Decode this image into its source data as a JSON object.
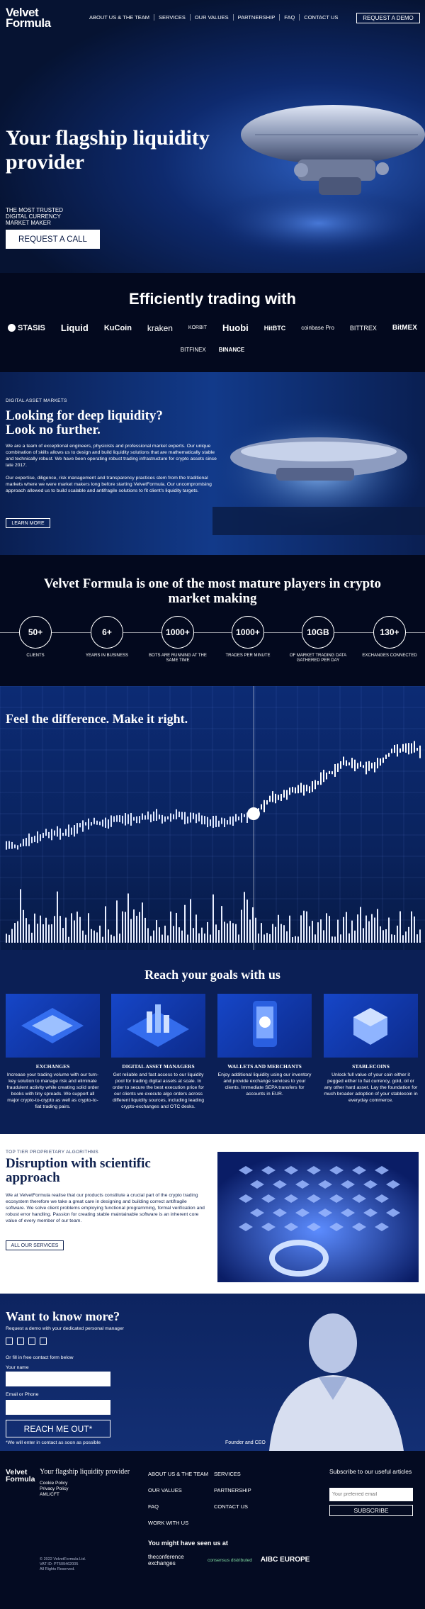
{
  "header": {
    "logo_line1": "Velvet",
    "logo_line2": "Formula",
    "nav": [
      "ABOUT US & THE TEAM",
      "SERVICES",
      "OUR VALUES",
      "PARTNERSHIP",
      "FAQ",
      "CONTACT US"
    ],
    "cta": "REQUEST A DEMO"
  },
  "hero": {
    "title": "Your flagship liquidity provider",
    "subtitle": "THE MOST TRUSTED DIGITAL CURRENCY MARKET MAKER",
    "button": "REQUEST A CALL"
  },
  "trading": {
    "title": "Efficiently trading with",
    "row1": [
      "STASIS",
      "Liquid",
      "KuCoin",
      "kraken",
      "KORBIT",
      "Huobi",
      "HitBTC",
      "coinbase Pro",
      "BITTREX",
      "BitMEX"
    ],
    "row2": [
      "BITFINEX",
      "BINANCE"
    ]
  },
  "deep": {
    "tag": "DIGITAL ASSET MARKETS",
    "title_line1": "Looking for deep liquidity?",
    "title_line2": "Look no further.",
    "p1": "We are a team of exceptional engineers, physicists and professional market experts. Our unique combination of skills allows us to design and build liquidity solutions that are mathematically stable and technically robust. We have been operating robust trading infrastructure for crypto assets since late 2017.",
    "p2": "Our expertise, diligence, risk management and transparency practices stem from the traditional markets where we were market makers long before starting VelvetFormula. Our uncompromising approach allowed us to build scalable and antifragile solutions to fit client's liquidity targets.",
    "button": "LEARN MORE"
  },
  "stats": {
    "title": "Velvet Formula is one of the most mature players in crypto market making",
    "items": [
      {
        "value": "50+",
        "label": "CLIENTS"
      },
      {
        "value": "6+",
        "label": "YEARS IN BUSINESS"
      },
      {
        "value": "1000+",
        "label": "BOTS ARE RUNNING AT THE SAME TIME"
      },
      {
        "value": "1000+",
        "label": "TRADES PER MINUTE"
      },
      {
        "value": "10GB",
        "label": "OF MARKET TRADING DATA GATHERED PER DAY"
      },
      {
        "value": "130+",
        "label": "EXCHANGES CONNECTED"
      }
    ]
  },
  "chart": {
    "title": "Feel the difference. Make it right."
  },
  "goals": {
    "title": "Reach your goals with us",
    "cards": [
      {
        "title": "EXCHANGES",
        "text": "Increase your trading volume with our turn-key solution to manage risk and eliminate fraudulent activity while creating solid order books with tiny spreads. We support all major crypto-to-crypto as well as crypto-to-fiat trading pairs."
      },
      {
        "title": "DIGITAL ASSET MANAGERS",
        "text": "Get reliable and fast access to our liquidity pool for trading digital assets at scale. In order to secure the best execution price for our clients we execute algo orders across different liquidity sources, including leading crypto-exchanges and OTC desks."
      },
      {
        "title": "WALLETS AND MERCHANTS",
        "text": "Enjoy additional liquidity using our inventory and provide exchange services to your clients. Immediate SEPA transfers for accounts in EUR."
      },
      {
        "title": "STABLECOINS",
        "text": "Unlock full value of your coin either it pegged either to fiat currency, gold, oil or any other hard asset. Lay the foundation for much broader adoption of your stablecoin in everyday commerce."
      }
    ]
  },
  "disrupt": {
    "tag": "TOP TIER PROPRIETARY ALGORITHMS",
    "title_line1": "Disruption with scientific",
    "title_line2": "approach",
    "text": "We at VelvetFormula realise that our products constitute a crucial part of the crypto trading ecosystem therefore we take a great care in designing and building correct antifragile software. We solve client problems employing functional programming, formal verification and robust error handling. Passion for creating stable maintainable software is an inherent core value of every member of our team.",
    "button": "ALL OUR SERVICES"
  },
  "contact": {
    "title": "Want to know more?",
    "sub": "Request a demo with your dedicated personal manager",
    "or_fill": "Or fill in free contact form below",
    "name_label": "Your name",
    "email_label": "Email or Phone",
    "button": "REACH ME OUT*",
    "note": "*We will enter in contact as soon as possible",
    "person_role": "Founder and CEO"
  },
  "footer": {
    "logo_line1": "Velvet",
    "logo_line2": "Formula",
    "tagline": "Your flagship liquidity provider",
    "legal": [
      "Cookie Policy",
      "Privacy Policy",
      "AML/CFT"
    ],
    "col1": [
      "ABOUT US & THE TEAM",
      "OUR VALUES",
      "FAQ",
      "WORK WITH US"
    ],
    "col2": [
      "SERVICES",
      "PARTNERSHIP",
      "CONTACT US"
    ],
    "subscribe_title": "Subscribe to our useful articles",
    "subscribe_placeholder": "Your preferred email",
    "subscribe_button": "SUBSCRIBE",
    "seen_title": "You might have seen us at",
    "seen": [
      "theconference exchanges",
      "consensus distributed",
      "AIBC EUROPE"
    ],
    "copyright": [
      "© 2022 VelvetFormula Ltd.",
      "VAT ID: PT509462005",
      "All Rights Reserved."
    ]
  },
  "colors": {
    "navy": "#071433",
    "accent_blue": "#1646c8",
    "white": "#ffffff"
  }
}
